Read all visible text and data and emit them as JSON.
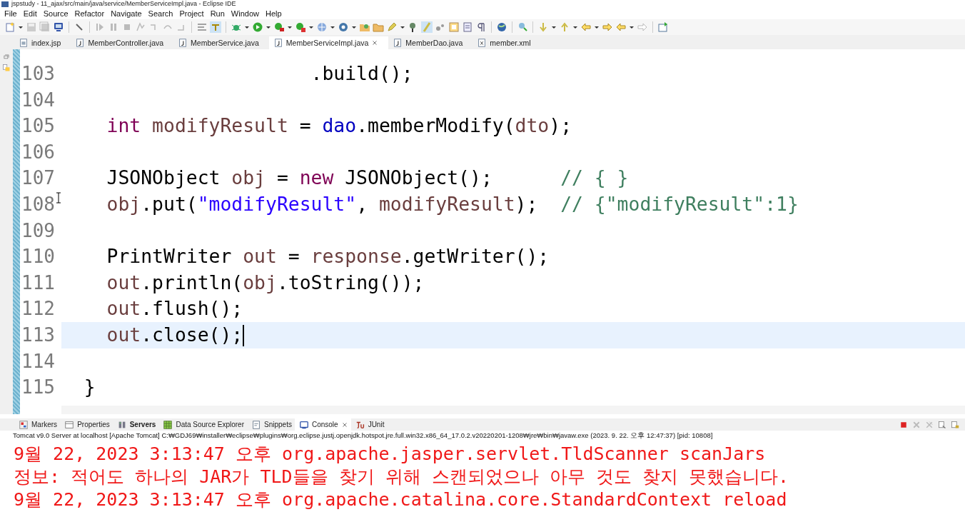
{
  "window": {
    "title": "jspstudy - 11_ajax/src/main/java/service/MemberServiceImpl.java - Eclipse IDE"
  },
  "menu": [
    "File",
    "Edit",
    "Source",
    "Refactor",
    "Navigate",
    "Search",
    "Project",
    "Run",
    "Window",
    "Help"
  ],
  "editor_tabs": [
    {
      "label": "index.jsp",
      "kind": "jsp",
      "selected": false
    },
    {
      "label": "MemberController.java",
      "kind": "java",
      "selected": false
    },
    {
      "label": "MemberService.java",
      "kind": "java",
      "selected": false
    },
    {
      "label": "MemberServiceImpl.java",
      "kind": "java",
      "selected": true
    },
    {
      "label": "MemberDao.java",
      "kind": "java",
      "selected": false
    },
    {
      "label": "member.xml",
      "kind": "xml",
      "selected": false
    }
  ],
  "code_lines": [
    {
      "number": "103",
      "current": false,
      "tokens": [
        {
          "text": "                      .build();",
          "kind": "plain"
        }
      ]
    },
    {
      "number": "104",
      "current": false
    },
    {
      "number": "105",
      "current": false,
      "tokens": [
        {
          "text": "    int ",
          "kind": "keyword"
        },
        {
          "text": "modifyResult",
          "kind": "local"
        },
        {
          "text": " = ",
          "kind": "plain"
        },
        {
          "text": "dao",
          "kind": "field"
        },
        {
          "text": ".memberModify(",
          "kind": "plain"
        },
        {
          "text": "dto",
          "kind": "local"
        },
        {
          "text": ");",
          "kind": "plain"
        }
      ]
    },
    {
      "number": "106",
      "current": false
    },
    {
      "number": "107",
      "current": false,
      "tokens": [
        {
          "text": "    JSONObject ",
          "kind": "plain"
        },
        {
          "text": "obj",
          "kind": "local"
        },
        {
          "text": " = ",
          "kind": "plain"
        },
        {
          "text": "new",
          "kind": "keyword"
        },
        {
          "text": " JSONObject();      ",
          "kind": "plain"
        },
        {
          "text": "// { }",
          "kind": "comment"
        }
      ]
    },
    {
      "number": "108",
      "current": false,
      "tokens": [
        {
          "text": "    obj",
          "kind": "local"
        },
        {
          "text": ".put(",
          "kind": "plain"
        },
        {
          "text": "\"modifyResult\"",
          "kind": "string"
        },
        {
          "text": ", ",
          "kind": "plain"
        },
        {
          "text": "modifyResult",
          "kind": "local"
        },
        {
          "text": ");  ",
          "kind": "plain"
        },
        {
          "text": "// {\"modifyResult\":1}",
          "kind": "comment"
        }
      ]
    },
    {
      "number": "109",
      "current": false
    },
    {
      "number": "110",
      "current": false,
      "tokens": [
        {
          "text": "    PrintWriter ",
          "kind": "plain"
        },
        {
          "text": "out",
          "kind": "local"
        },
        {
          "text": " = ",
          "kind": "plain"
        },
        {
          "text": "response",
          "kind": "local"
        },
        {
          "text": ".getWriter();",
          "kind": "plain"
        }
      ]
    },
    {
      "number": "111",
      "current": false,
      "tokens": [
        {
          "text": "    out",
          "kind": "local"
        },
        {
          "text": ".println(",
          "kind": "plain"
        },
        {
          "text": "obj",
          "kind": "local"
        },
        {
          "text": ".toString());",
          "kind": "plain"
        }
      ]
    },
    {
      "number": "112",
      "current": false,
      "tokens": [
        {
          "text": "    out",
          "kind": "local"
        },
        {
          "text": ".flush();",
          "kind": "plain"
        }
      ]
    },
    {
      "number": "113",
      "current": true,
      "tokens": [
        {
          "text": "    out",
          "kind": "local"
        },
        {
          "text": ".close();",
          "kind": "plain"
        }
      ]
    },
    {
      "number": "114",
      "current": false
    },
    {
      "number": "115",
      "current": false,
      "tokens": [
        {
          "text": "  }",
          "kind": "plain"
        }
      ]
    }
  ],
  "bottom_tabs": [
    {
      "label": "Markers",
      "kind": "markers",
      "selected": false
    },
    {
      "label": "Properties",
      "kind": "properties",
      "selected": false
    },
    {
      "label": "Servers",
      "kind": "servers",
      "selected": false
    },
    {
      "label": "Data Source Explorer",
      "kind": "datasource",
      "selected": false
    },
    {
      "label": "Snippets",
      "kind": "snippets",
      "selected": false
    },
    {
      "label": "Console",
      "kind": "console",
      "selected": true
    },
    {
      "label": "JUnit",
      "kind": "junit",
      "selected": false
    }
  ],
  "console": {
    "process": "Tomcat v9.0 Server at localhost [Apache Tomcat] C:₩GDJ69₩installer₩eclipse₩plugins₩org.eclipse.justj.openjdk.hotspot.jre.full.win32.x86_64_17.0.2.v20220201-1208₩jre₩bin₩javaw.exe  (2023. 9. 22. 오후 12:47:37) [pid: 10808]",
    "lines": [
      "9월 22, 2023 3:13:47 오후 org.apache.jasper.servlet.TldScanner scanJars",
      "정보: 적어도 하나의 JAR가 TLD들을 찾기 위해 스캔되었으나 아무 것도 찾지 못했습니다.",
      "9월 22, 2023 3:13:47 오후 org.apache.catalina.core.StandardContext reload"
    ]
  }
}
